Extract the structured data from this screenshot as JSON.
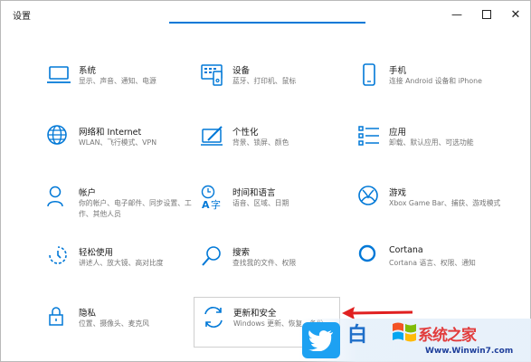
{
  "window": {
    "title": "设置",
    "minimize_icon": "minimize-icon",
    "maximize_icon": "maximize-icon",
    "close_icon": "close-icon"
  },
  "accent_color": "#0078d7",
  "categories": [
    {
      "name": "系统",
      "desc": "显示、声音、通知、电源",
      "icon": "laptop-icon"
    },
    {
      "name": "设备",
      "desc": "蓝牙、打印机、鼠标",
      "icon": "keyboard-device-icon"
    },
    {
      "name": "手机",
      "desc": "连接 Android 设备和 iPhone",
      "icon": "phone-icon"
    },
    {
      "name": "网络和 Internet",
      "desc": "WLAN、飞行模式、VPN",
      "icon": "globe-icon"
    },
    {
      "name": "个性化",
      "desc": "背景、锁屏、颜色",
      "icon": "pen-tablet-icon"
    },
    {
      "name": "应用",
      "desc": "卸载、默认应用、可选功能",
      "icon": "apps-list-icon"
    },
    {
      "name": "帐户",
      "desc": "你的帐户、电子邮件、同步设置、工作、其他人员",
      "icon": "person-icon"
    },
    {
      "name": "时间和语言",
      "desc": "语音、区域、日期",
      "icon": "time-language-icon"
    },
    {
      "name": "游戏",
      "desc": "Xbox Game Bar、捕获、游戏模式",
      "icon": "xbox-icon"
    },
    {
      "name": "轻松使用",
      "desc": "讲述人、放大镜、高对比度",
      "icon": "ease-of-access-icon"
    },
    {
      "name": "搜索",
      "desc": "查找我的文件、权限",
      "icon": "search-icon"
    },
    {
      "name": "Cortana",
      "desc": "Cortana 语言、权限、通知",
      "icon": "cortana-icon"
    },
    {
      "name": "隐私",
      "desc": "位置、摄像头、麦克风",
      "icon": "lock-icon"
    },
    {
      "name": "更新和安全",
      "desc": "Windows 更新、恢复、备份",
      "icon": "update-icon"
    }
  ],
  "watermark": {
    "logo_text": "白",
    "brand_text": "系统之家",
    "url": "Www.Winwin7.com"
  }
}
